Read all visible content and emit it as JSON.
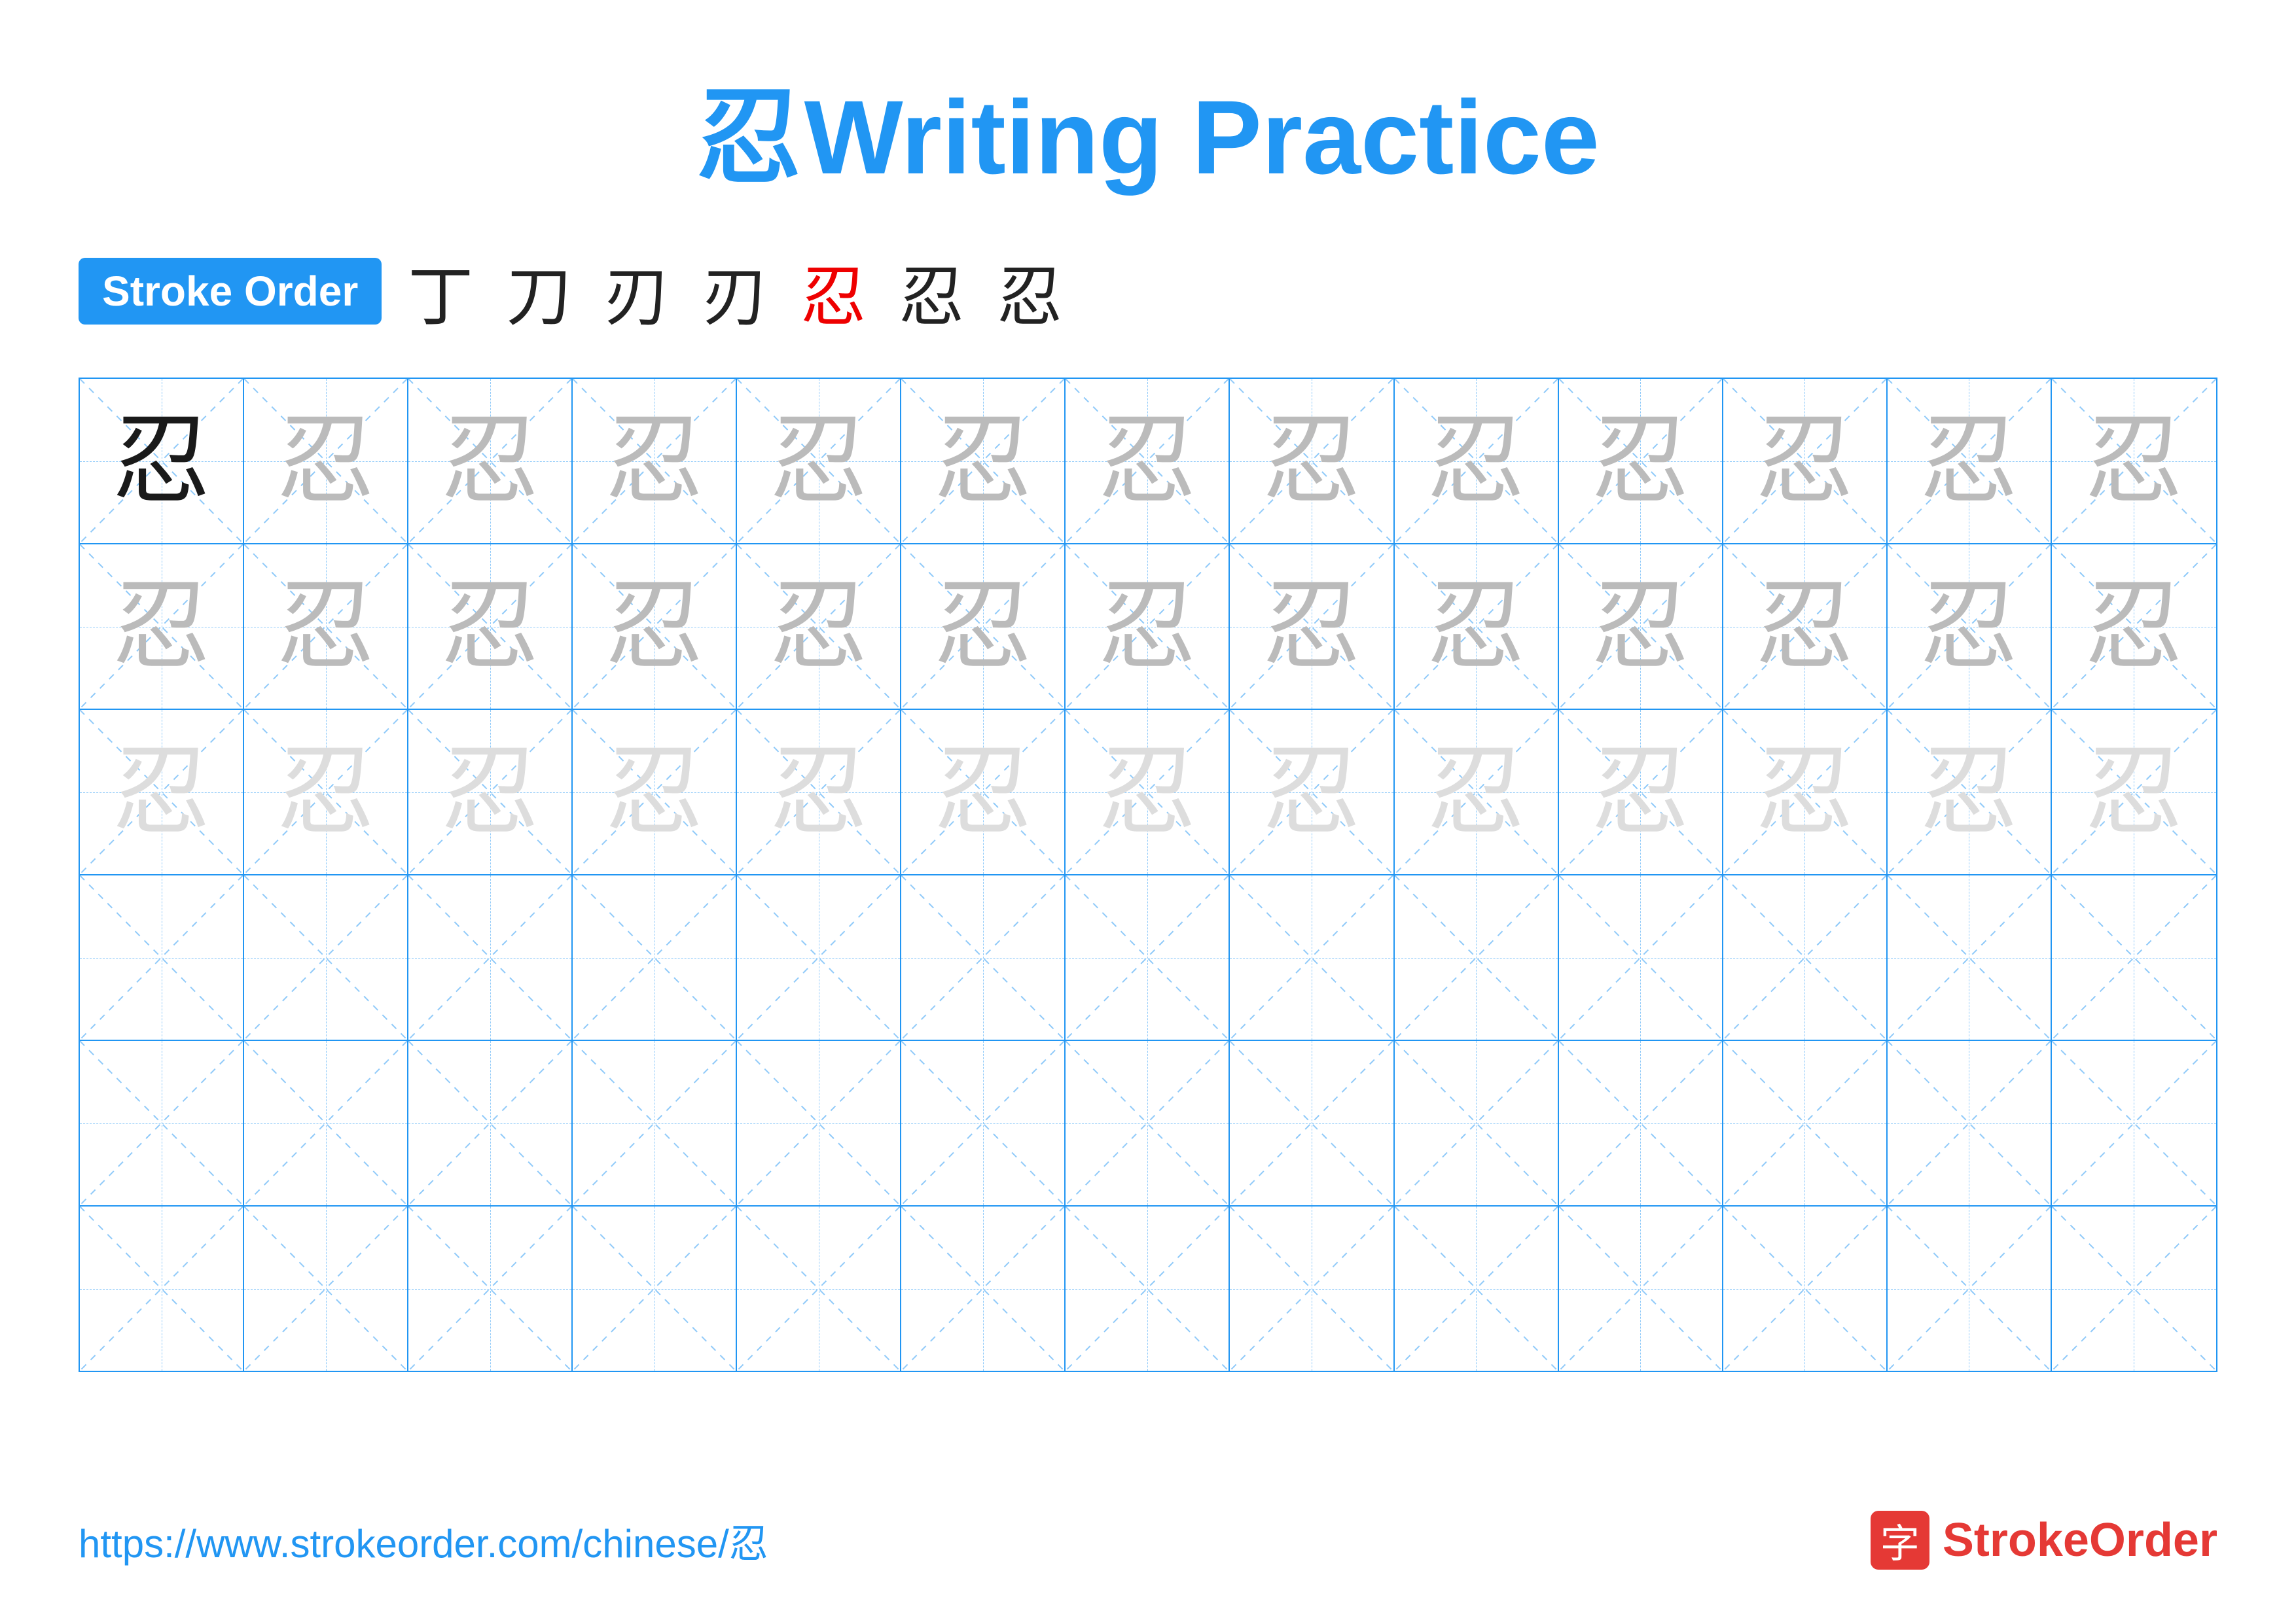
{
  "title": {
    "char": "忍",
    "text": " Writing Practice"
  },
  "stroke_order": {
    "badge_label": "Stroke Order",
    "strokes": [
      "丁",
      "刀",
      "刃",
      "刃",
      "忍",
      "忍",
      "忍"
    ]
  },
  "grid": {
    "rows": 6,
    "cols": 13,
    "row_types": [
      "dark_then_medium",
      "medium",
      "light",
      "empty",
      "empty",
      "empty"
    ]
  },
  "footer": {
    "url": "https://www.strokeorder.com/chinese/忍",
    "logo_char": "字",
    "logo_text": "StrokeOrder"
  }
}
